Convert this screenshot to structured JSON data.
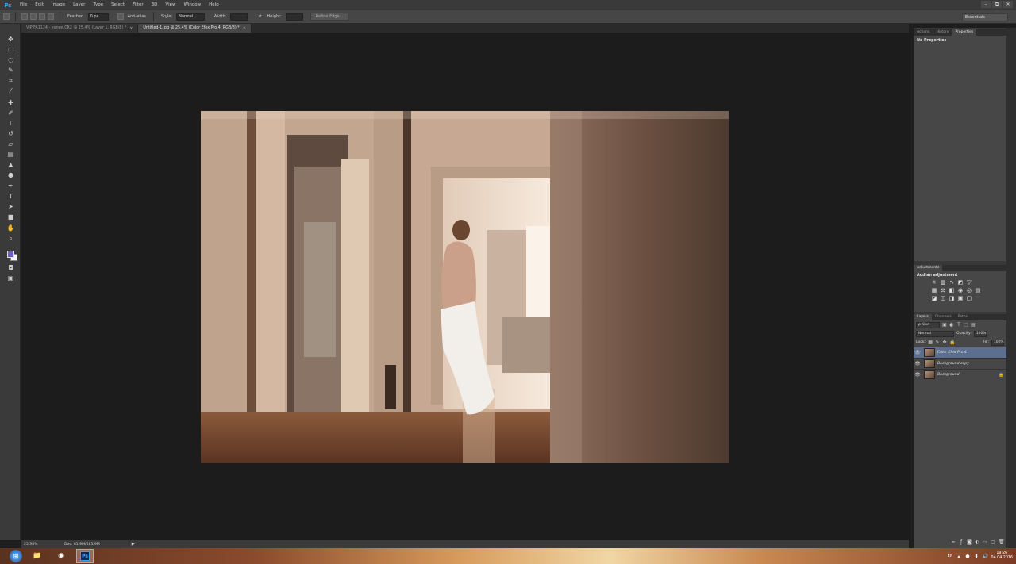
{
  "app": {
    "logo": "Ps"
  },
  "menu": [
    "File",
    "Edit",
    "Image",
    "Layer",
    "Type",
    "Select",
    "Filter",
    "3D",
    "View",
    "Window",
    "Help"
  ],
  "window_controls": {
    "minimize": "–",
    "restore": "⧉",
    "close": "✕"
  },
  "options": {
    "feather_label": "Feather:",
    "feather_value": "0 px",
    "antialias_label": "Anti-alias",
    "style_label": "Style:",
    "style_value": "Normal",
    "width_label": "Width:",
    "height_label": "Height:",
    "refine_edge": "Refine Edge...",
    "workspace": "Essentials"
  },
  "doc_tabs": [
    {
      "title": "VIP FA1124 - копия.CR2 @ 25,4% (Layer 1, RGB/8) *",
      "active": false
    },
    {
      "title": "Untitled-1.jpg @ 25,4% (Color Efex Pro 4, RGB/8) *",
      "active": true
    }
  ],
  "status": {
    "zoom": "25,38%",
    "doc": "Doc: 61,9M/185,9M",
    "arrow": "▶"
  },
  "panels": {
    "props_tabs": [
      "Actions",
      "History",
      "Properties"
    ],
    "props_empty": "No Properties",
    "adj_tab": "Adjustments",
    "adj_title": "Add an adjustment",
    "layers_tabs": [
      "Layers",
      "Channels",
      "Paths"
    ],
    "kind": "ρ Kind",
    "blend_mode": "Normal",
    "opacity_label": "Opacity:",
    "opacity_value": "100%",
    "lock_label": "Lock:",
    "fill_label": "Fill:",
    "fill_value": "100%"
  },
  "layers": [
    {
      "name": "Color Efex Pro 4",
      "selected": true,
      "locked": false
    },
    {
      "name": "Background copy",
      "selected": false,
      "locked": false
    },
    {
      "name": "Background",
      "selected": false,
      "locked": true
    }
  ],
  "tray": {
    "lang": "EN",
    "time": "19:26",
    "date": "04.04.2016"
  }
}
